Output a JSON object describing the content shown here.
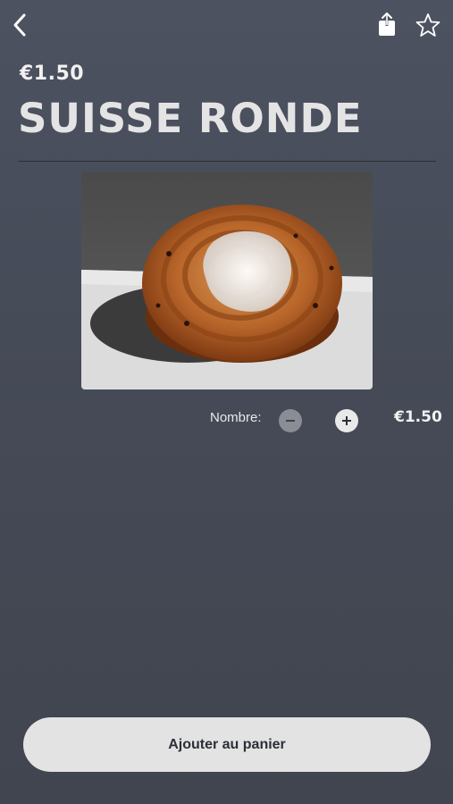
{
  "header": {
    "back_icon": "chevron-left-icon",
    "share_icon": "share-icon",
    "favorite_icon": "star-outline-icon"
  },
  "product": {
    "price": "€1.50",
    "name": "SUISSE RONDE",
    "image_alt": "Suisse ronde pastry photo"
  },
  "quantity": {
    "label": "Nombre:",
    "minus_icon": "minus-icon",
    "plus_icon": "plus-icon",
    "total": "€1.50"
  },
  "cart": {
    "button_label": "Ajouter au panier"
  }
}
